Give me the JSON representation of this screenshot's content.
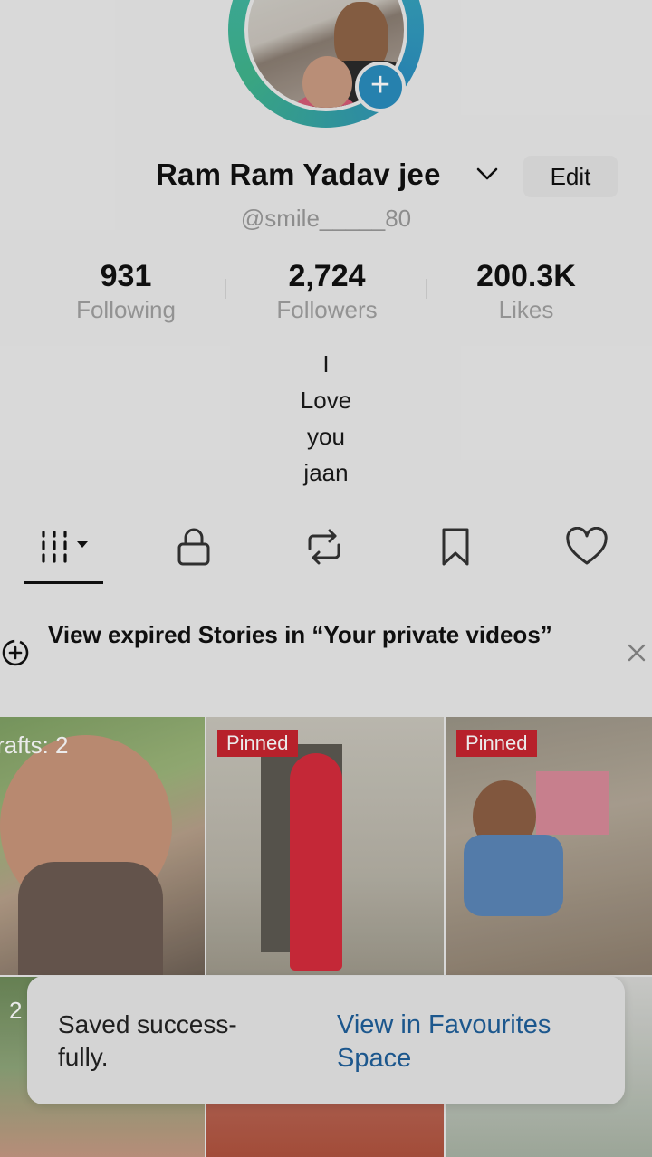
{
  "profile": {
    "display_name": "Ram Ram Yadav jee",
    "handle": "@smile_____80",
    "edit_label": "Edit",
    "bio_lines": [
      "I",
      "Love",
      "you",
      "jaan"
    ]
  },
  "stats": [
    {
      "value": "931",
      "label": "Following"
    },
    {
      "value": "2,724",
      "label": "Followers"
    },
    {
      "value": "200.3K",
      "label": "Likes"
    }
  ],
  "tabs": {
    "icons": [
      "videos-grid-icon",
      "lock-icon",
      "repost-icon",
      "bookmark-icon",
      "heart-icon"
    ],
    "selected": "videos-grid-icon"
  },
  "banner": {
    "text": "View expired Stories in “Your private videos”"
  },
  "grid": {
    "drafts_label": "rafts: 2",
    "pinned_label": "Pinned",
    "partial_count": "2"
  },
  "toast": {
    "message": "Saved success-fully.",
    "action": "View in Favourites Space"
  },
  "colors": {
    "pinned_badge": "#c7242f",
    "link": "#1f5f9a",
    "avatar_ring": "#2c8fbe",
    "plus_button": "#2a8cbd"
  }
}
